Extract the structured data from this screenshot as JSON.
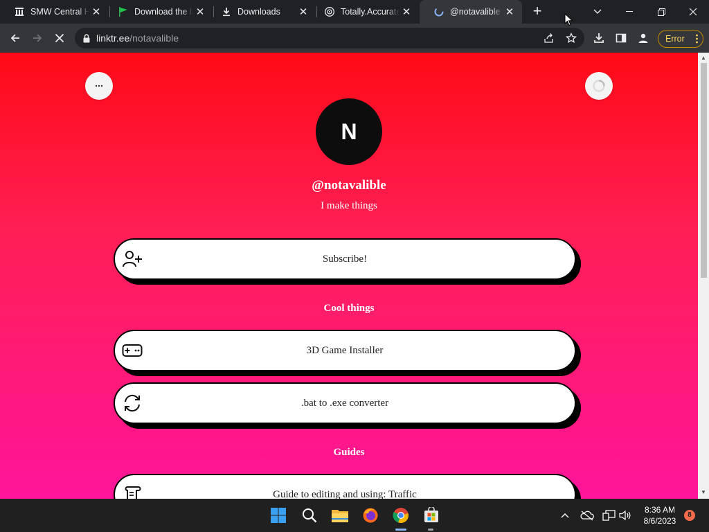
{
  "browser": {
    "tabs": [
      {
        "title": "SMW Central Ha",
        "icon": "smwcentral-icon"
      },
      {
        "title": "Download the la",
        "icon": "green-flag-icon"
      },
      {
        "title": "Downloads",
        "icon": "download-icon"
      },
      {
        "title": "Totally.Accurate",
        "icon": "globe-icon"
      },
      {
        "title": "@notavalible | L",
        "icon": "linktree-icon",
        "active": true
      }
    ],
    "address": {
      "host": "linktr.ee",
      "path": "/notavalible"
    },
    "error_label": "Error",
    "accent_color": "#fdd663"
  },
  "profile": {
    "avatar_letter": "N",
    "handle": "@notavalible",
    "bio": "I make things"
  },
  "links": {
    "subscribe": {
      "label": "Subscribe!",
      "icon": "add-user-icon"
    },
    "section_cool": "Cool things",
    "game_installer": {
      "label": "3D Game Installer",
      "icon": "gamepad-icon"
    },
    "bat_converter": {
      "label": ".bat to .exe converter",
      "icon": "refresh-icon"
    },
    "section_guides": "Guides",
    "guide_traffic": {
      "label": "Guide to editing and using: Traffic",
      "icon": "scroll-icon"
    }
  },
  "page_colors": {
    "gradient_top": "#ff0a16",
    "gradient_bottom": "#ff159b"
  },
  "taskbar": {
    "apps": [
      "windows-start-icon",
      "search-icon",
      "file-explorer-icon",
      "firefox-icon",
      "chrome-icon",
      "microsoft-store-icon"
    ],
    "time": "8:36 AM",
    "date": "8/6/2023",
    "notifications": "8"
  }
}
